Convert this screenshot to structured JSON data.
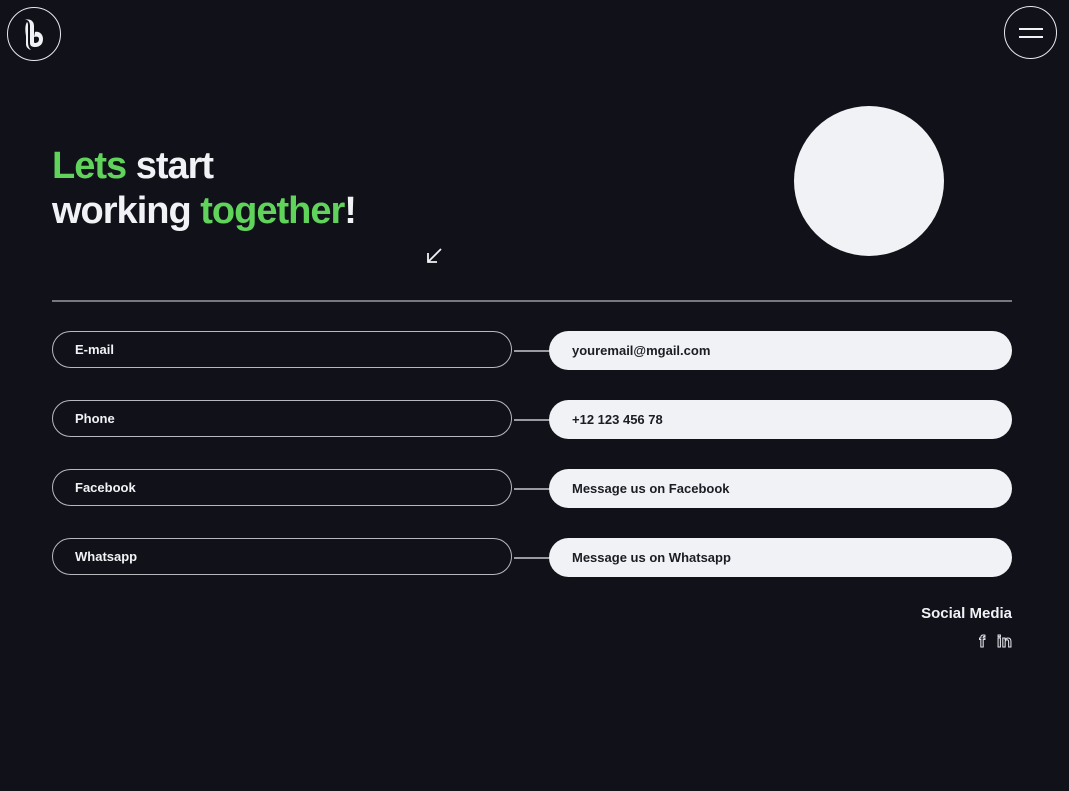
{
  "header": {
    "logo_icon": "brand-b-logo",
    "menu_icon": "hamburger-menu-icon"
  },
  "hero": {
    "line1_word1": "Lets",
    "line1_word2": " start",
    "line2_word1": "working ",
    "line2_word2": "together",
    "line2_word3": "!",
    "arrow_icon": "arrow-down-left-icon",
    "accent_color": "#5fd35a"
  },
  "contact_rows": [
    {
      "label": "E-mail",
      "value": "youremail@mgail.com"
    },
    {
      "label": "Phone",
      "value": "+12 123 456 78"
    },
    {
      "label": "Facebook",
      "value": "Message us on Facebook"
    },
    {
      "label": "Whatsapp",
      "value": "Message us on Whatsapp"
    }
  ],
  "social": {
    "title": "Social Media",
    "icons": [
      {
        "name": "facebook-icon",
        "glyph": "f"
      },
      {
        "name": "linkedin-icon",
        "glyph": "in"
      }
    ]
  }
}
